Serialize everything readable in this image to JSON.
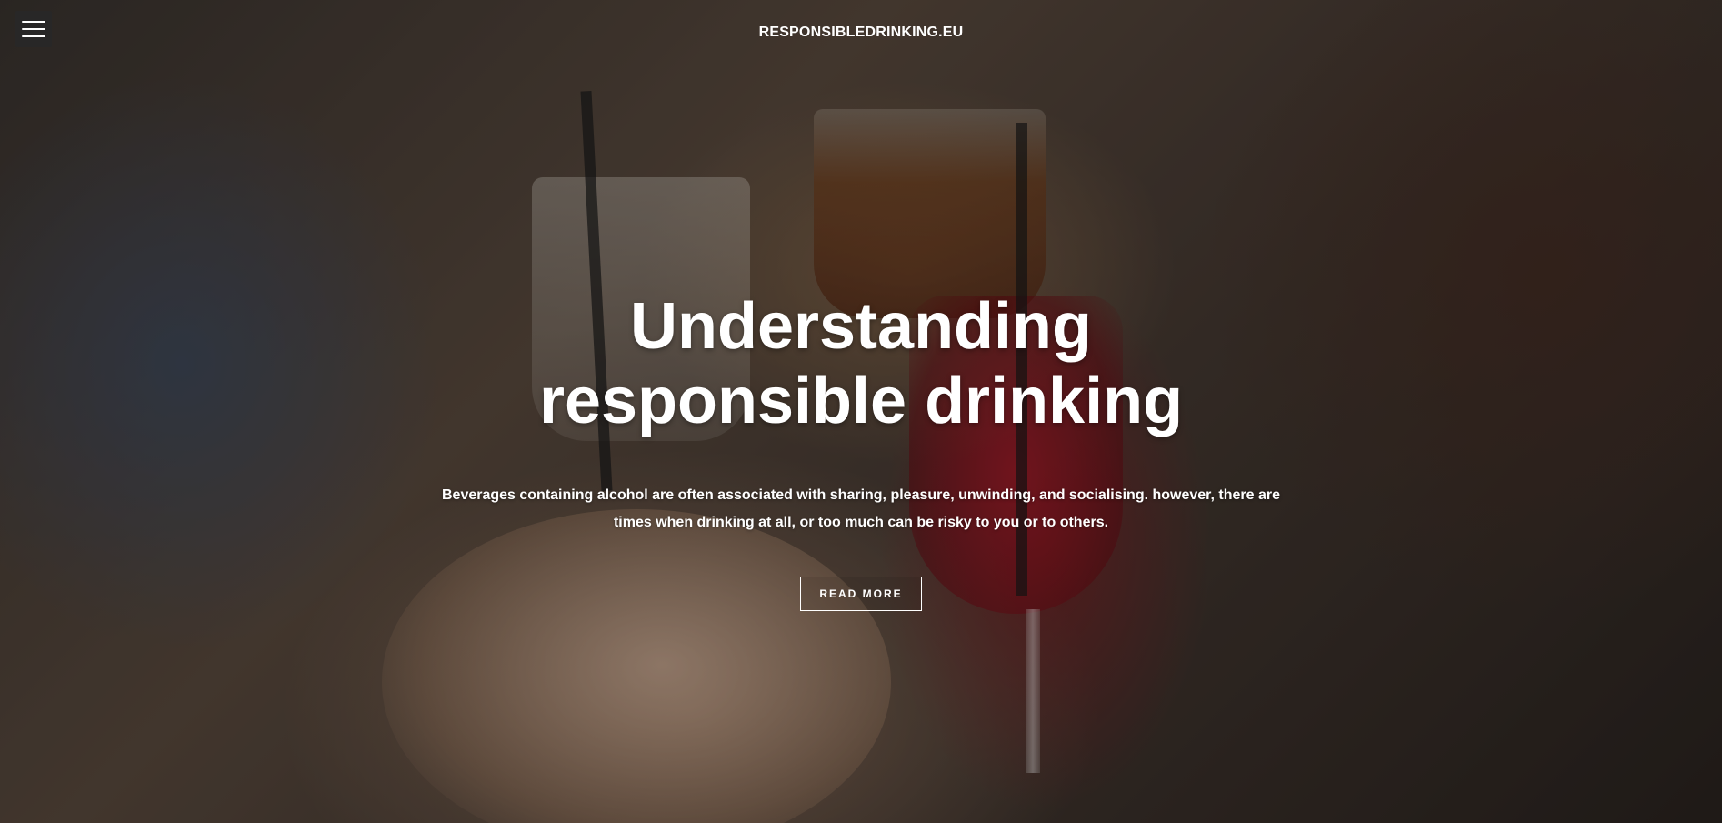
{
  "header": {
    "menu_icon": "hamburger-menu-icon",
    "site_title": "RESPONSIBLEDRINKING.EU"
  },
  "hero": {
    "headline": "Understanding responsible drinking",
    "subtext": "Beverages containing alcohol are often associated with sharing, pleasure, unwinding, and socialising. however, there are times when drinking at all, or too much can be risky to you or to others.",
    "cta_label": "READ MORE"
  }
}
